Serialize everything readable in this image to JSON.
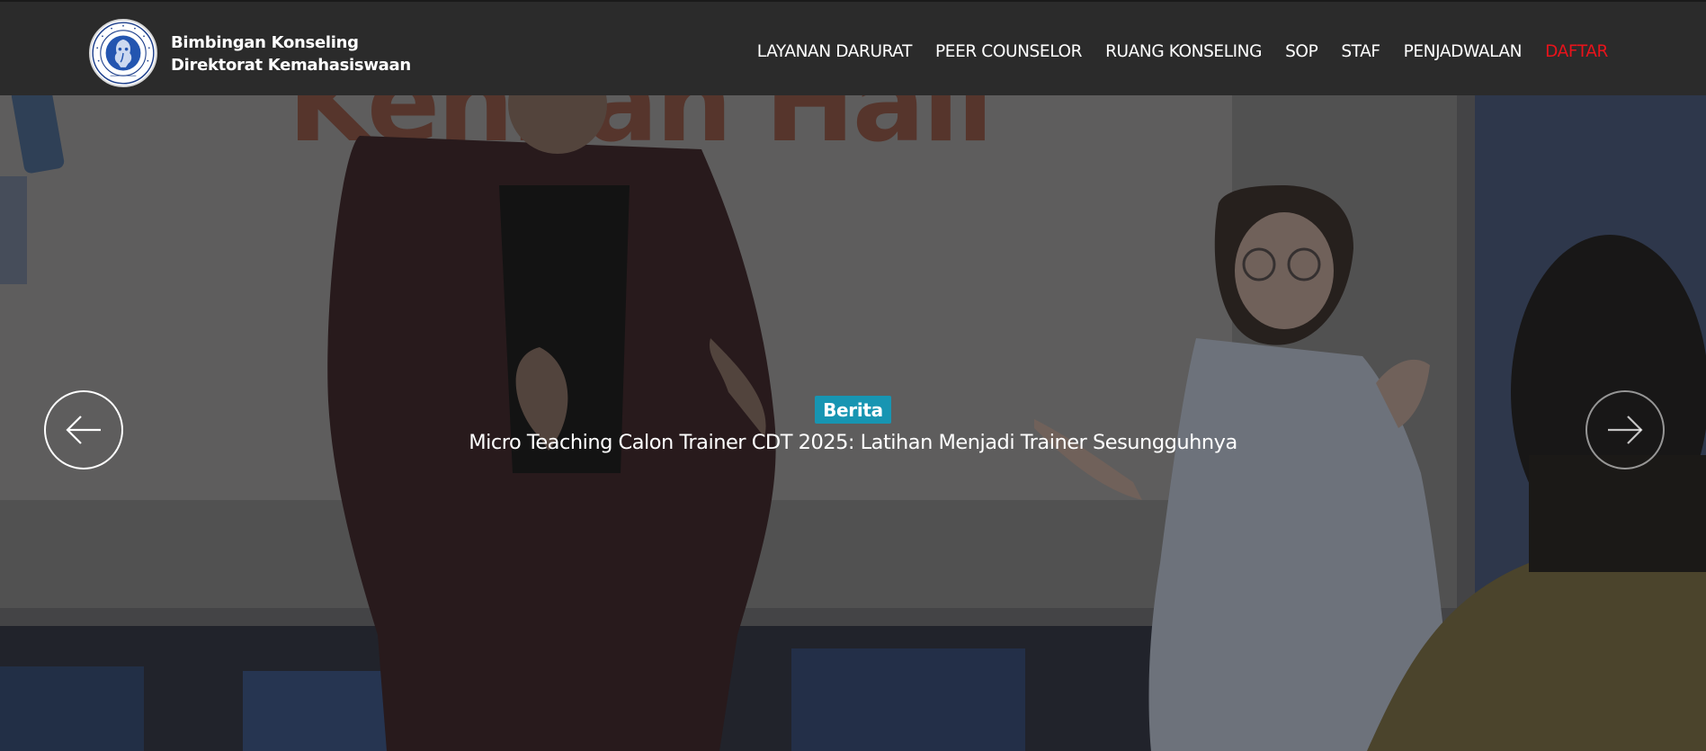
{
  "header": {
    "logo": {
      "icon": "ganesha-emblem-icon",
      "ring_text": "INSTITUT TEKNOLOGI BANDUNG",
      "year": "1920"
    },
    "brand_line1": "Bimbingan Konseling",
    "brand_line2": "Direktorat Kemahasiswaan",
    "nav": [
      {
        "label": "LAYANAN DARURAT"
      },
      {
        "label": "PEER COUNSELOR"
      },
      {
        "label": "RUANG KONSELING"
      },
      {
        "label": "SOP"
      },
      {
        "label": "STAF"
      },
      {
        "label": "PENJADWALAN"
      },
      {
        "label": "DAFTAR"
      }
    ],
    "accent_color": "#e8131b"
  },
  "hero": {
    "badge": "Berita",
    "badge_color": "#1795b2",
    "headline": "Micro Teaching Calon Trainer CDT 2025: Latihan Menjadi Trainer Sesungguhnya",
    "backdrop_text": "Kennan Hall",
    "prev_icon": "arrow-left-icon",
    "next_icon": "arrow-right-icon"
  }
}
